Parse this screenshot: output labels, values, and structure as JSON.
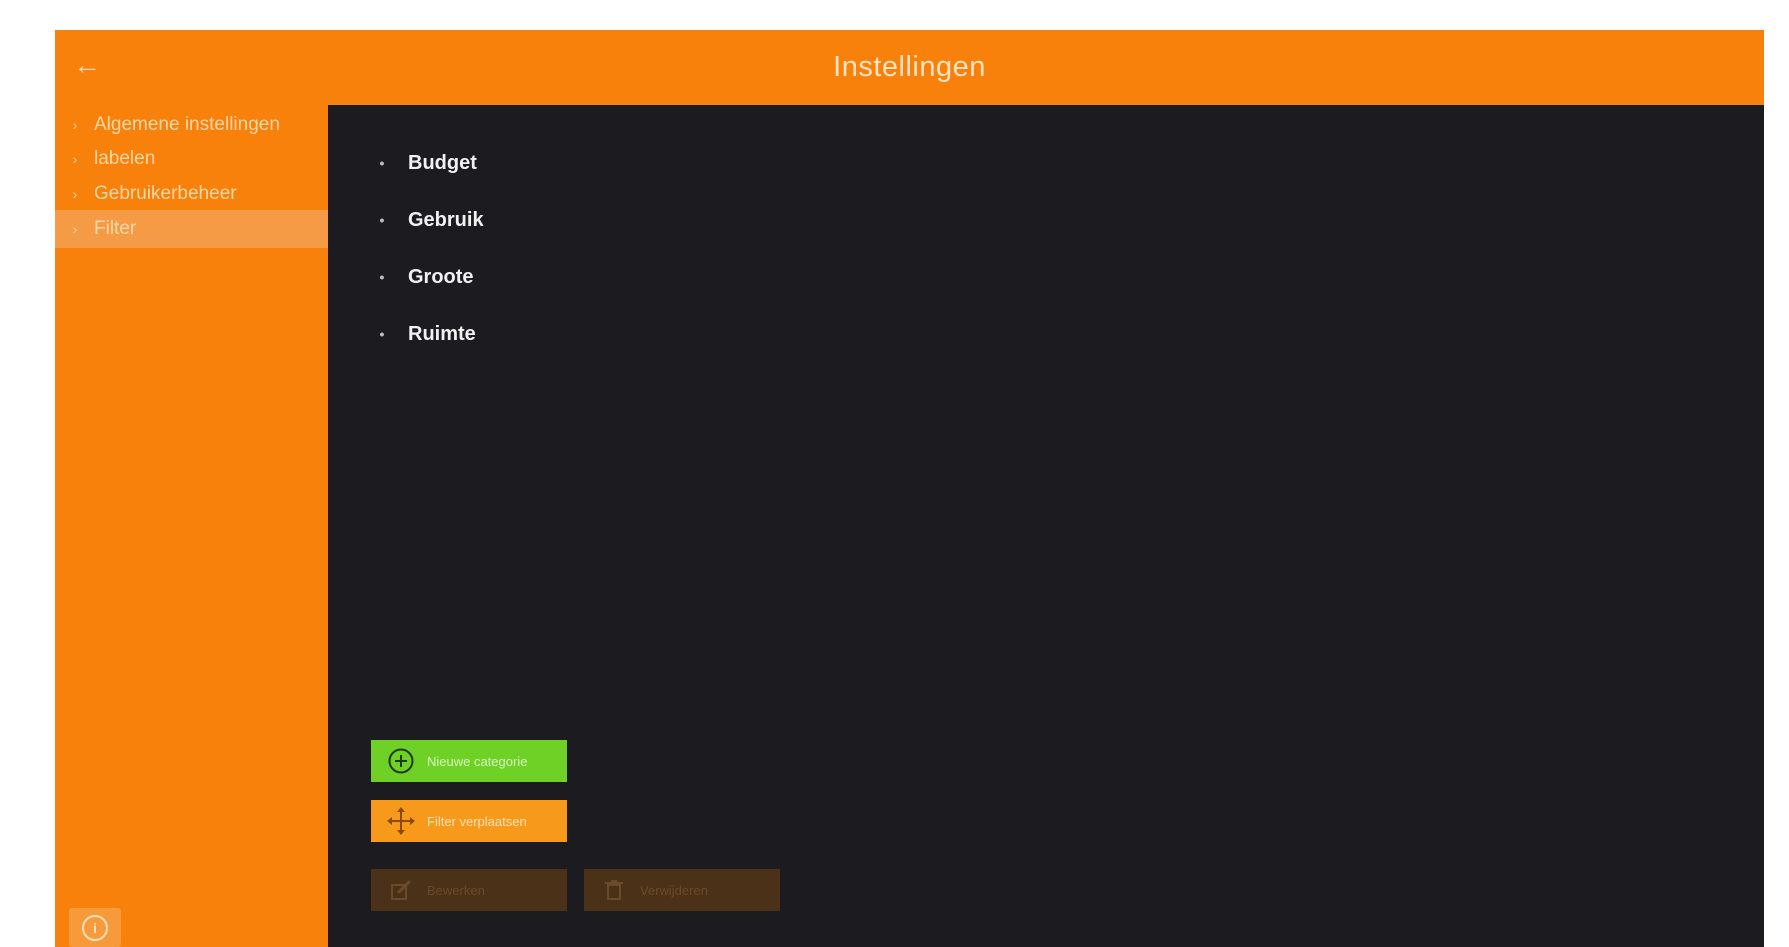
{
  "header": {
    "title": "Instellingen",
    "back_icon": "arrow-left-icon"
  },
  "sidebar": {
    "items": [
      {
        "label": "Algemene instellingen",
        "icon": "chevron-right-icon"
      },
      {
        "label": "labelen",
        "icon": "chevron-right-icon"
      },
      {
        "label": "Gebruikerbeheer",
        "icon": "chevron-right-icon"
      },
      {
        "label": "Filter",
        "icon": "chevron-right-icon",
        "active": true
      }
    ],
    "info_icon": "info-icon"
  },
  "filters": {
    "items": [
      {
        "label": "Budget"
      },
      {
        "label": "Gebruik"
      },
      {
        "label": "Groote"
      },
      {
        "label": "Ruimte"
      }
    ]
  },
  "actions": {
    "add_category": {
      "label": "Nieuwe categorie",
      "icon": "plus-circle-icon"
    },
    "move": {
      "label": "Filter verplaatsen",
      "icon": "move-icon"
    },
    "edit": {
      "label": "Bewerken",
      "icon": "edit-icon"
    },
    "delete": {
      "label": "Verwijderen",
      "icon": "trash-icon"
    }
  },
  "colors": {
    "accent": "#f7810b",
    "content_bg": "#1b1b20",
    "green_button": "#6fd125",
    "orange_button": "#f79a1c",
    "disabled_button": "#4b3118"
  }
}
